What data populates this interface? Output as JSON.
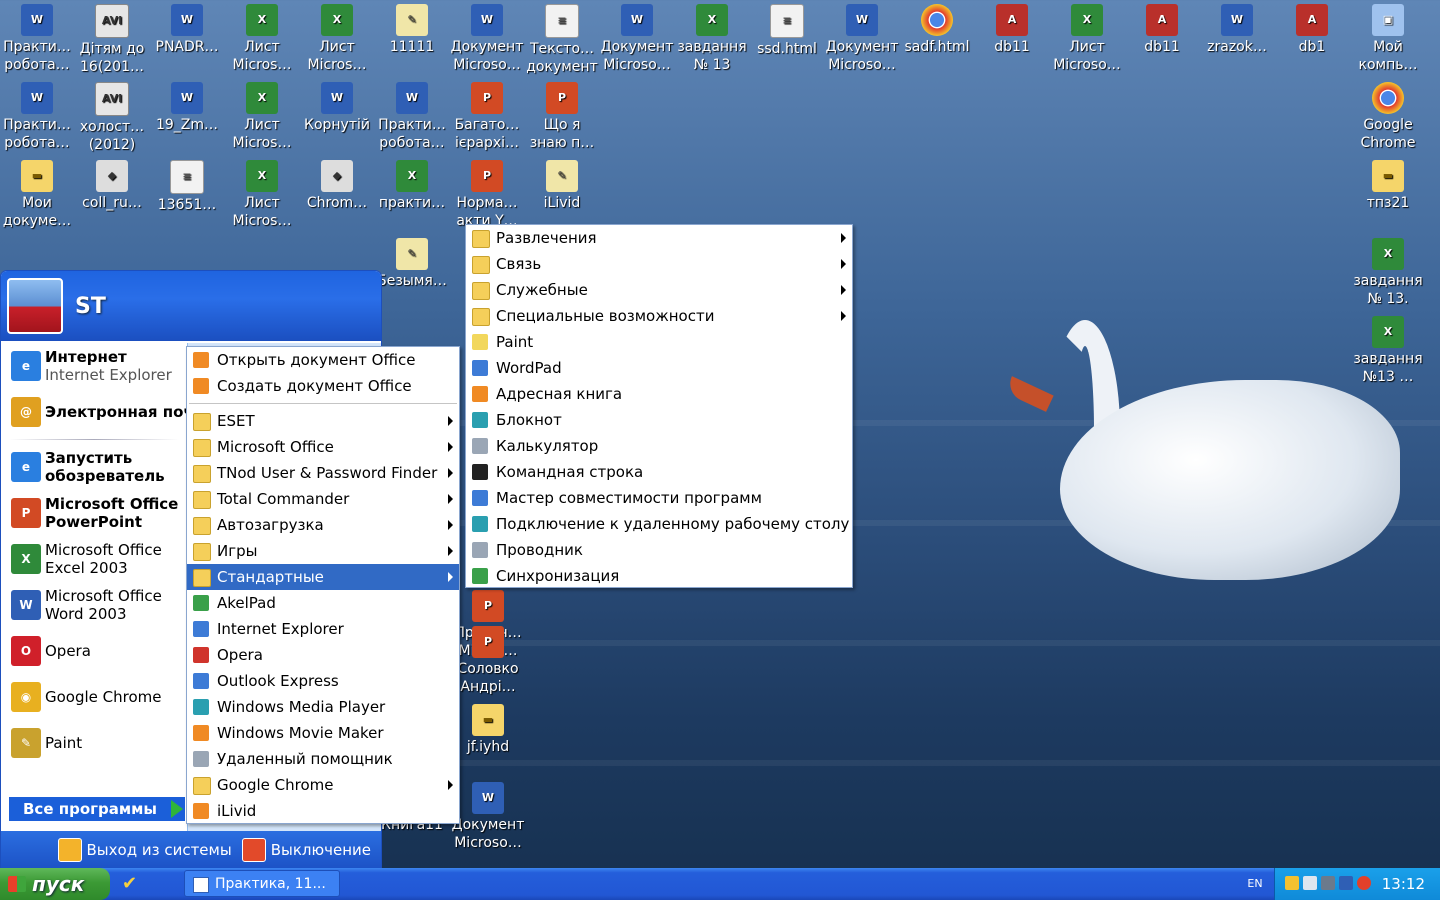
{
  "desktop": {
    "row1": [
      {
        "label": "Практи… робота…",
        "type": "word"
      },
      {
        "label": "Дітям до 16(201…",
        "type": "avi"
      },
      {
        "label": "PNADR…",
        "type": "word"
      },
      {
        "label": "Лист Micros…",
        "type": "excel"
      },
      {
        "label": "Лист Micros…",
        "type": "excel"
      },
      {
        "label": "11111",
        "type": "paint"
      },
      {
        "label": "Документ Microso…",
        "type": "word"
      },
      {
        "label": "Тексто… документ",
        "type": "txt"
      },
      {
        "label": "Документ Microso…",
        "type": "word"
      },
      {
        "label": "завдання № 13",
        "type": "excel"
      },
      {
        "label": "ssd.html",
        "type": "txt"
      },
      {
        "label": "Документ Microso…",
        "type": "word"
      },
      {
        "label": "sadf.html",
        "type": "chrome"
      },
      {
        "label": "db11",
        "type": "db"
      },
      {
        "label": "Лист Microso…",
        "type": "excel"
      },
      {
        "label": "db11",
        "type": "db"
      },
      {
        "label": "zrazok…",
        "type": "word"
      },
      {
        "label": "db1",
        "type": "db"
      },
      {
        "label": "Мой компь…",
        "type": "computer"
      }
    ],
    "row2": [
      {
        "label": "Практи… робота…",
        "type": "word"
      },
      {
        "label": "холост… (2012)",
        "type": "avi"
      },
      {
        "label": "19_Zm…",
        "type": "word"
      },
      {
        "label": "Лист Micros…",
        "type": "excel"
      },
      {
        "label": "Корнутій",
        "type": "word"
      },
      {
        "label": "Практи… робота…",
        "type": "word"
      },
      {
        "label": "Багато… ієрархі…",
        "type": "ppt"
      },
      {
        "label": "Що я знаю п…",
        "type": "ppt"
      }
    ],
    "row3": [
      {
        "label": "Мои докуме…",
        "type": "folder"
      },
      {
        "label": "coll_ru…",
        "type": "misc"
      },
      {
        "label": "13651…",
        "type": "txt"
      },
      {
        "label": "Лист Micros…",
        "type": "excel"
      },
      {
        "label": "Chrom…",
        "type": "misc"
      },
      {
        "label": "практи…",
        "type": "excel"
      },
      {
        "label": "Норма… акти Y…",
        "type": "ppt"
      },
      {
        "label": "iLivid",
        "type": "paint"
      }
    ],
    "row4_labels": [
      "Безымя…"
    ],
    "right_column": [
      {
        "label": "Google Chrome",
        "type": "chrome"
      },
      {
        "label": "тпз21",
        "type": "folder"
      },
      {
        "label": "завдання № 13.",
        "type": "excel"
      },
      {
        "label": "завдання №13 …",
        "type": "excel"
      }
    ],
    "behind_menu": [
      {
        "label": "Презен… Micros…",
        "type": "ppt"
      },
      {
        "label": "Соловко Андрі…",
        "type": "ppt"
      },
      {
        "label": "jf.iyhd",
        "type": "folder"
      },
      {
        "label": "Книга11",
        "type": "excel"
      },
      {
        "label": "Документ Microso…",
        "type": "word"
      }
    ]
  },
  "start_menu": {
    "username": "ST",
    "pinned": [
      {
        "title": "Интернет",
        "subtitle": "Internet Explorer",
        "icon": "ie-icon",
        "color": "#2a7fe0",
        "glyph": "e"
      },
      {
        "title": "Электронная почта",
        "subtitle": "",
        "icon": "mail-icon",
        "color": "#e0a020",
        "glyph": "@"
      }
    ],
    "recent": [
      {
        "name": "Запустить обозреватель …",
        "icon": "ie-icon",
        "color": "#2a7fe0",
        "glyph": "e",
        "bold": true
      },
      {
        "name": "Microsoft Office PowerPoint 20…",
        "icon": "powerpoint-icon",
        "color": "#d24a24",
        "glyph": "P",
        "bold": true
      },
      {
        "name": "Microsoft Office Excel 2003",
        "icon": "excel-icon",
        "color": "#2f8a3a",
        "glyph": "X",
        "bold": false
      },
      {
        "name": "Microsoft Office Word 2003",
        "icon": "word-icon",
        "color": "#2f5fb5",
        "glyph": "W",
        "bold": false
      },
      {
        "name": "Opera",
        "icon": "opera-icon",
        "color": "#d0202a",
        "glyph": "O",
        "bold": false
      },
      {
        "name": "Google Chrome",
        "icon": "chrome-icon",
        "color": "#e8b020",
        "glyph": "◉",
        "bold": false
      },
      {
        "name": "Paint",
        "icon": "paint-icon",
        "color": "#c9a22e",
        "glyph": "✎",
        "bold": false
      }
    ],
    "all_programs": "Все программы",
    "logoff": "Выход из системы",
    "shutdown": "Выключение"
  },
  "programs_menu": {
    "top": [
      "Открыть документ Office",
      "Создать документ Office"
    ],
    "items": [
      {
        "label": "ESET",
        "submenu": true,
        "icon": "folder"
      },
      {
        "label": "Microsoft Office",
        "submenu": true,
        "icon": "folder"
      },
      {
        "label": "TNod User & Password Finder",
        "submenu": true,
        "icon": "folder"
      },
      {
        "label": "Total Commander",
        "submenu": true,
        "icon": "folder"
      },
      {
        "label": "Автозагрузка",
        "submenu": true,
        "icon": "folder"
      },
      {
        "label": "Игры",
        "submenu": true,
        "icon": "folder"
      },
      {
        "label": "Стандартные",
        "submenu": true,
        "icon": "folder",
        "selected": true
      },
      {
        "label": "AkelPad",
        "submenu": false,
        "icon": "green"
      },
      {
        "label": "Internet Explorer",
        "submenu": false,
        "icon": "blue"
      },
      {
        "label": "Opera",
        "submenu": false,
        "icon": "red"
      },
      {
        "label": "Outlook Express",
        "submenu": false,
        "icon": "blue"
      },
      {
        "label": "Windows Media Player",
        "submenu": false,
        "icon": "teal"
      },
      {
        "label": "Windows Movie Maker",
        "submenu": false,
        "icon": "orange"
      },
      {
        "label": "Удаленный помощник",
        "submenu": false,
        "icon": "gray"
      },
      {
        "label": "Google Chrome",
        "submenu": true,
        "icon": "folder"
      },
      {
        "label": "iLivid",
        "submenu": false,
        "icon": "orange"
      }
    ]
  },
  "accessories_menu": {
    "items": [
      {
        "label": "Развлечения",
        "submenu": true,
        "icon": "folder"
      },
      {
        "label": "Связь",
        "submenu": true,
        "icon": "folder"
      },
      {
        "label": "Служебные",
        "submenu": true,
        "icon": "folder"
      },
      {
        "label": "Специальные возможности",
        "submenu": true,
        "icon": "folder"
      },
      {
        "label": "Paint",
        "submenu": false,
        "icon": "paint"
      },
      {
        "label": "WordPad",
        "submenu": false,
        "icon": "blue"
      },
      {
        "label": "Адресная книга",
        "submenu": false,
        "icon": "orange"
      },
      {
        "label": "Блокнот",
        "submenu": false,
        "icon": "teal"
      },
      {
        "label": "Калькулятор",
        "submenu": false,
        "icon": "gray"
      },
      {
        "label": "Командная строка",
        "submenu": false,
        "icon": "dark"
      },
      {
        "label": "Мастер совместимости программ",
        "submenu": false,
        "icon": "blue"
      },
      {
        "label": "Подключение к удаленному рабочему столу",
        "submenu": false,
        "icon": "teal"
      },
      {
        "label": "Проводник",
        "submenu": false,
        "icon": "gray"
      },
      {
        "label": "Синхронизация",
        "submenu": false,
        "icon": "green"
      }
    ]
  },
  "taskbar": {
    "start_label": "пуск",
    "task_title": "Практика, 11...",
    "lang": "EN",
    "clock": "13:12"
  }
}
